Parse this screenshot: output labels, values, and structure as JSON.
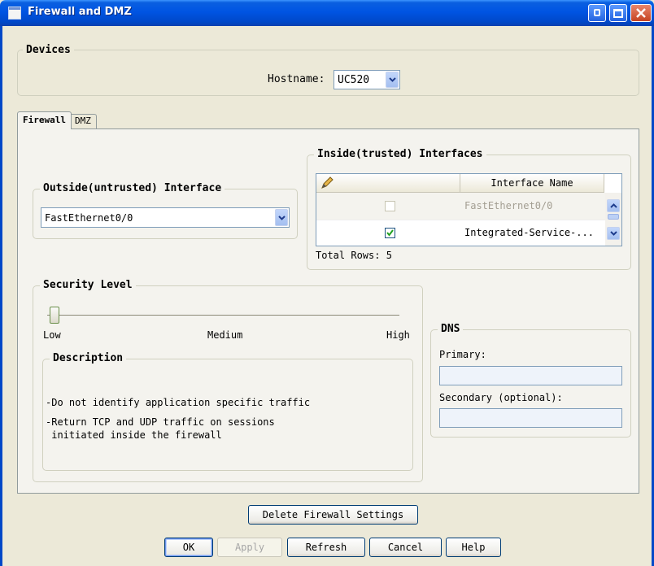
{
  "window": {
    "title": "Firewall and DMZ"
  },
  "devices": {
    "legend": "Devices",
    "hostname_label": "Hostname:",
    "hostname_value": "UC520"
  },
  "tabs": [
    {
      "label": "Firewall",
      "selected": true
    },
    {
      "label": "DMZ",
      "selected": false
    }
  ],
  "outside": {
    "legend": "Outside(untrusted) Interface",
    "value": "FastEthernet0/0"
  },
  "inside": {
    "legend": "Inside(trusted) Interfaces",
    "column_header": "Interface Name",
    "rows": [
      {
        "checked": false,
        "enabled": false,
        "name": "FastEthernet0/0"
      },
      {
        "checked": true,
        "enabled": true,
        "name": "Integrated-Service-..."
      }
    ],
    "total_rows": "Total Rows: 5"
  },
  "security": {
    "legend": "Security Level",
    "level_low": "Low",
    "level_medium": "Medium",
    "level_high": "High",
    "slider_value": "Low",
    "description_legend": "Description",
    "description_line1": "-Do not identify application specific traffic",
    "description_line2": "-Return TCP and UDP traffic on sessions",
    "description_line3": " initiated inside the firewall"
  },
  "dns": {
    "legend": "DNS",
    "primary_label": "Primary:",
    "primary_value": "",
    "secondary_label": "Secondary (optional):",
    "secondary_value": ""
  },
  "buttons": {
    "delete_firewall": "Delete Firewall Settings",
    "ok": "OK",
    "apply": "Apply",
    "refresh": "Refresh",
    "cancel": "Cancel",
    "help": "Help"
  },
  "colors": {
    "titlebar": "#0054e3",
    "window_bg": "#ece9d8",
    "disabled_text": "#a39e92"
  }
}
